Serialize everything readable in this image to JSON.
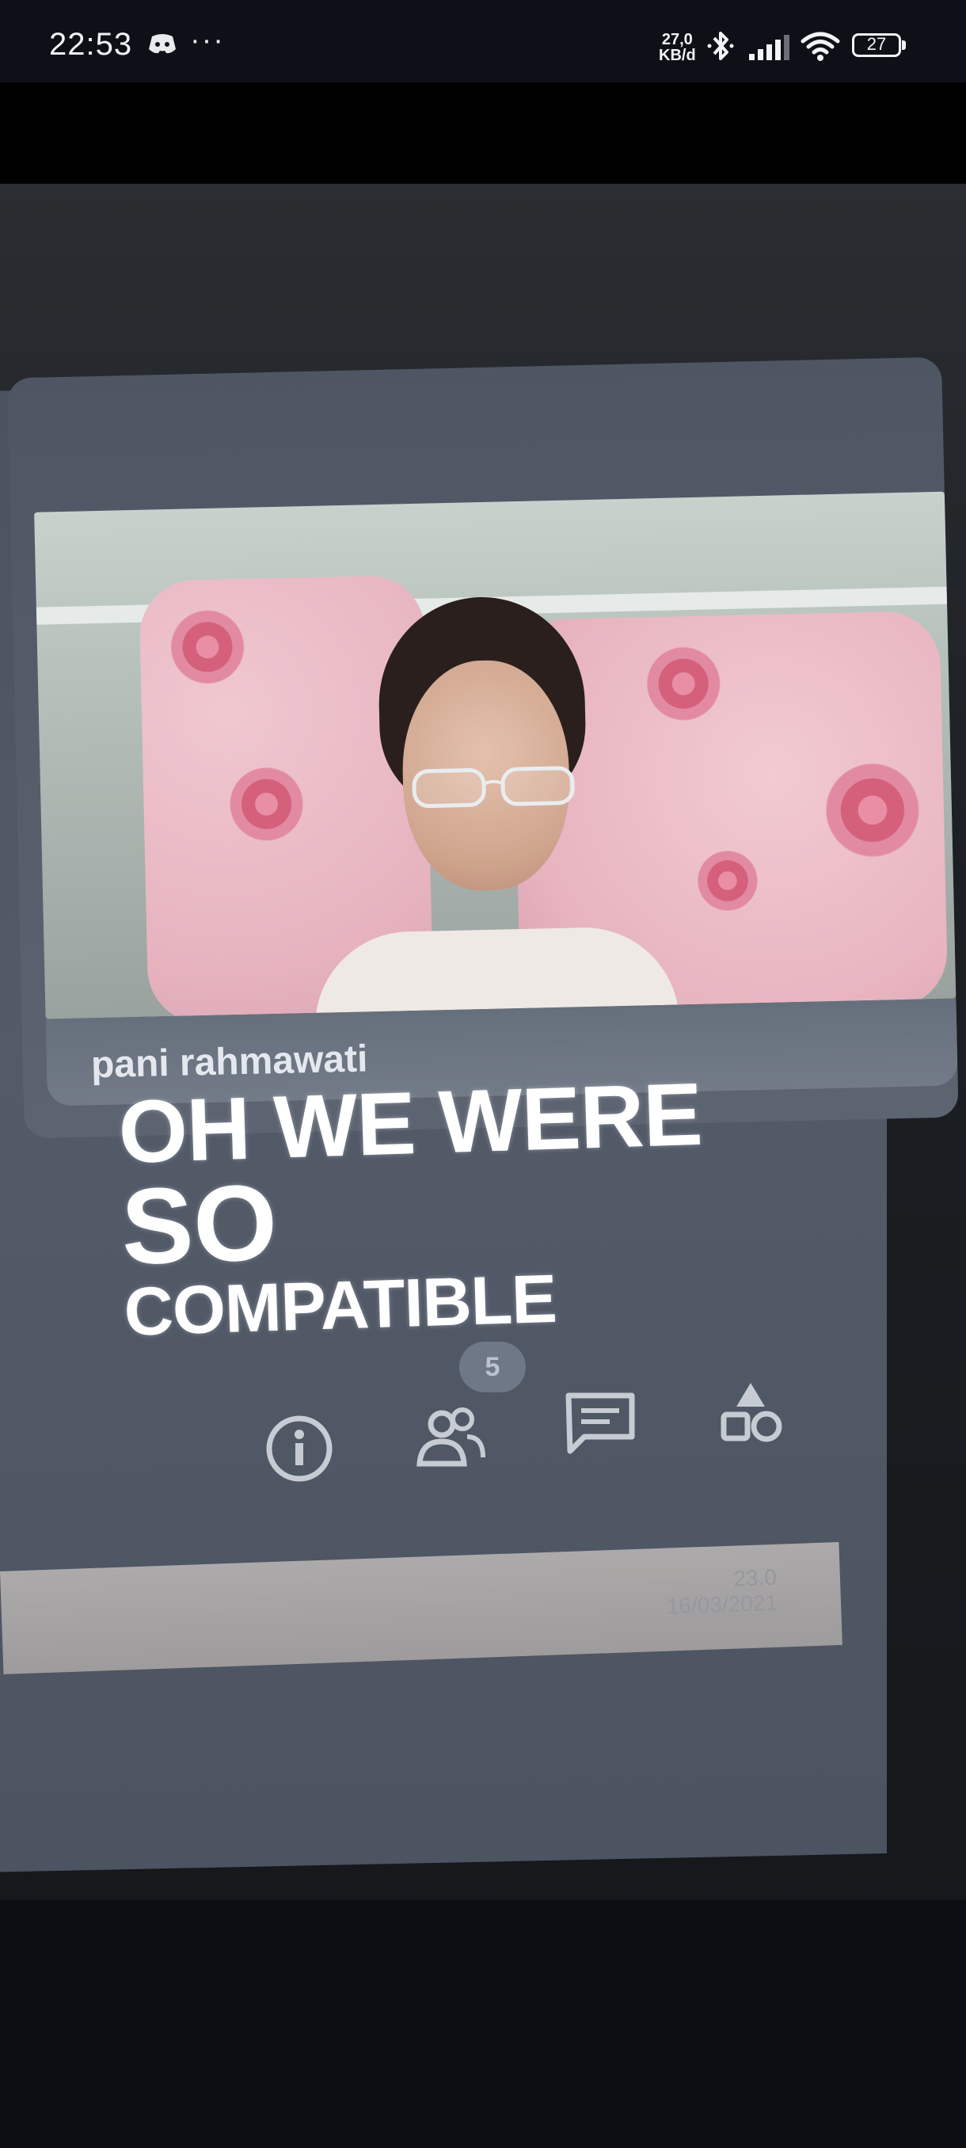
{
  "status_bar": {
    "time": "22:53",
    "more": "···",
    "net_speed_value": "27,0",
    "net_speed_unit": "KB/d",
    "battery": "27",
    "icons": [
      "discord-icon",
      "bluetooth-icon",
      "signal-icon",
      "wifi-icon",
      "battery-icon"
    ]
  },
  "photo": {
    "participant_name": "pani rahmawati",
    "caption": {
      "line1": "OH WE WERE",
      "line2": "SO",
      "line3": "COMPATIBLE"
    },
    "participants_badge": "5",
    "toolbar_icons": [
      "info-icon",
      "participants-icon",
      "chat-icon",
      "activities-icon"
    ],
    "taskbar_tray": {
      "time": "23.0",
      "date": "16/03/2021"
    }
  },
  "colors": {
    "status_bar_bg": "#0d1117",
    "screen_bg": "#4f5663",
    "caption_text": "#ffffff"
  }
}
